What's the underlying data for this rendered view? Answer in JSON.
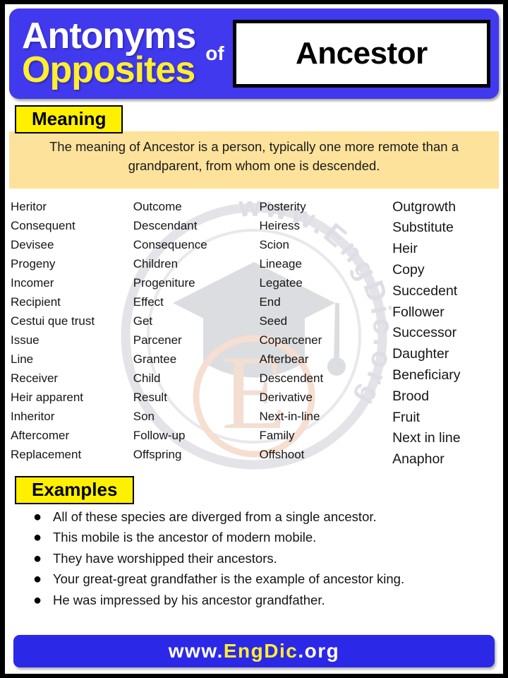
{
  "header": {
    "line1": "Antonyms",
    "line2": "Opposites",
    "connector": "of",
    "word": "Ancestor"
  },
  "meaning": {
    "label": "Meaning",
    "text": "The meaning of Ancestor is a person, typically one more remote than a grandparent, from whom one is descended."
  },
  "columns": [
    {
      "id": "column-1",
      "words": [
        "Heritor",
        "Consequent",
        "Devisee",
        "Progeny",
        "Incomer",
        "Recipient",
        "Cestui que trust",
        "Issue",
        "Line",
        "Receiver",
        "Heir apparent",
        "Inheritor",
        "Aftercomer",
        "Replacement"
      ]
    },
    {
      "id": "column-2",
      "words": [
        "Outcome",
        "Descendant",
        "Consequence",
        "Children",
        "Progeniture",
        "Effect",
        "Get",
        "Parcener",
        "Grantee",
        "Child",
        "Result",
        "Son",
        "Follow-up",
        "Offspring"
      ]
    },
    {
      "id": "column-3",
      "words": [
        "Posterity",
        "Heiress",
        "Scion",
        "Lineage",
        "Legatee",
        "End",
        "Seed",
        "Coparcener",
        "Afterbear",
        "Descendent",
        "Derivative",
        "Next-in-line",
        "Family",
        "Offshoot"
      ]
    },
    {
      "id": "column-4",
      "words": [
        "Outgrowth",
        "Substitute",
        "Heir",
        "Copy",
        "Succedent",
        "Follower",
        "Successor",
        "Daughter",
        "Beneficiary",
        "Brood",
        "Fruit",
        "Next in line",
        "Anaphor"
      ]
    }
  ],
  "examples": {
    "label": "Examples",
    "bullet": "●",
    "items": [
      "All of these species are diverged from a single ancestor.",
      "This mobile is the ancestor of modern mobile.",
      "They have worshipped their ancestors.",
      "Your great-great grandfather is the example of ancestor king.",
      "He was impressed by his ancestor grandfather."
    ]
  },
  "footer": {
    "prefix": "www.",
    "brand": "EngDic",
    "suffix": ".org"
  },
  "watermark": {
    "ring_text": "www.EngDic.org",
    "center_letter": "E"
  },
  "colors": {
    "blue": "#4139ee",
    "yellow": "#ffef2e",
    "tag_yellow": "#fff000",
    "meaning_bg": "#fce29b",
    "footer_blue": "#2b28e8"
  }
}
